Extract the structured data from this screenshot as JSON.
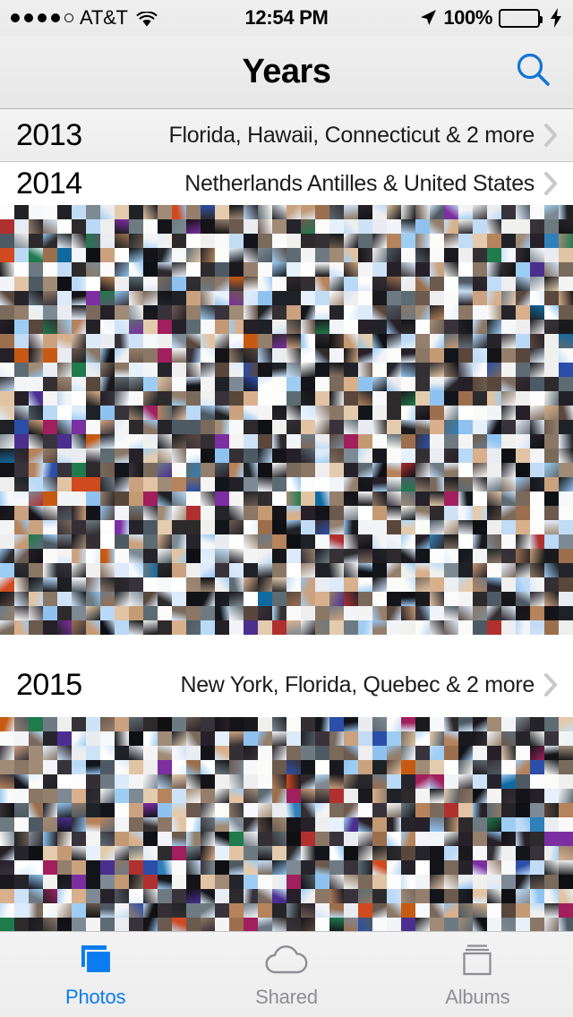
{
  "status_bar": {
    "signal_dots_filled": 4,
    "signal_dots_total": 5,
    "carrier": "AT&T",
    "wifi_icon": "wifi-icon",
    "time": "12:54 PM",
    "location_icon": "location-arrow-icon",
    "battery_percent": "100%",
    "battery_icon": "battery-full-icon",
    "charging_icon": "lightning-bolt-icon",
    "battery_color": "#4cd964"
  },
  "nav_bar": {
    "title": "Years",
    "search_icon": "search-icon",
    "accent_color": "#0a7bf0"
  },
  "years": [
    {
      "year": "2013",
      "places": "Florida, Hawaii, Connecticut & 2 more",
      "chevron_icon": "chevron-right-icon",
      "has_mosaic": false,
      "shaded": true
    },
    {
      "year": "2014",
      "places": "Netherlands Antilles & United States",
      "chevron_icon": "chevron-right-icon",
      "has_mosaic": true,
      "shaded": false,
      "mosaic_rows": 30
    },
    {
      "year": "2015",
      "places": "New York, Florida, Quebec & 2 more",
      "chevron_icon": "chevron-right-icon",
      "has_mosaic": true,
      "shaded": false,
      "mosaic_rows": 16
    }
  ],
  "tab_bar": {
    "active_index": 0,
    "active_color": "#0a7bf0",
    "inactive_color": "#8e8e93",
    "tabs": [
      {
        "label": "Photos",
        "icon": "photos-stack-icon"
      },
      {
        "label": "Shared",
        "icon": "cloud-icon"
      },
      {
        "label": "Albums",
        "icon": "albums-icon"
      }
    ]
  }
}
